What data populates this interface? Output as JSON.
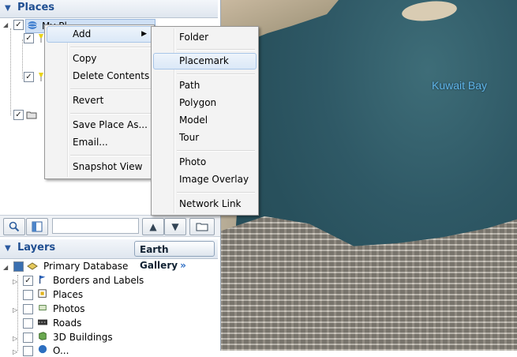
{
  "map": {
    "label": "Kuwait Bay"
  },
  "places": {
    "title": "Places",
    "tree_item_label": "My Pl..."
  },
  "toolbar": {
    "search_icon": "magnifier-icon",
    "panel_icon": "panel-toggle-icon",
    "up_icon": "up-arrow-icon",
    "down_icon": "down-arrow-icon",
    "folder_icon": "folder-icon"
  },
  "layers": {
    "title": "Layers",
    "gallery_label": "Earth Gallery",
    "gallery_chevron": "»",
    "items": [
      {
        "label": "Primary Database"
      },
      {
        "label": "Borders and Labels"
      },
      {
        "label": "Places"
      },
      {
        "label": "Photos"
      },
      {
        "label": "Roads"
      },
      {
        "label": "3D Buildings"
      },
      {
        "label": "O..."
      }
    ]
  },
  "context_menu": {
    "items": [
      "Add",
      "Copy",
      "Delete Contents",
      "Revert",
      "Save Place As...",
      "Email...",
      "Snapshot View"
    ]
  },
  "submenu": {
    "items": [
      "Folder",
      "Placemark",
      "Path",
      "Polygon",
      "Model",
      "Tour",
      "Photo",
      "Image Overlay",
      "Network Link"
    ]
  }
}
